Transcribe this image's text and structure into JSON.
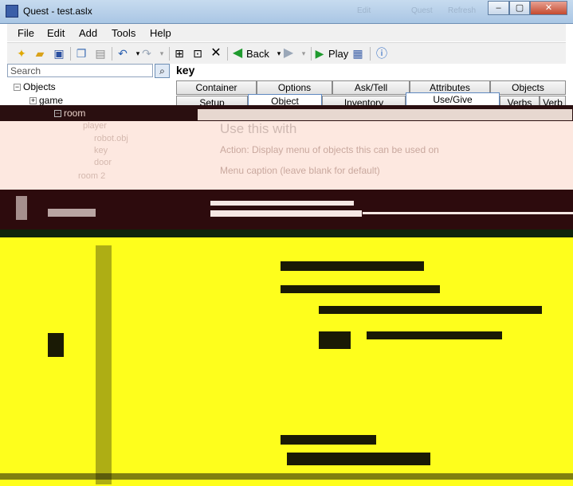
{
  "window": {
    "title": "Quest - test.aslx",
    "ghost_menu": [
      "Edit",
      "Quest",
      "Refresh"
    ],
    "controls": [
      "–",
      "▢",
      "✕"
    ]
  },
  "menu": [
    "File",
    "Edit",
    "Add",
    "Tools",
    "Help"
  ],
  "toolbar": {
    "back_label": "Back",
    "play_label": "Play",
    "icons": [
      "new-file-icon",
      "open-folder-icon",
      "save-icon",
      "copy-icon",
      "paste-icon",
      "undo-icon",
      "redo-icon",
      "add-object-icon",
      "add-room-icon",
      "delete-icon",
      "back-icon",
      "forward-icon",
      "play-icon",
      "log-icon",
      "help-icon"
    ]
  },
  "search": {
    "placeholder": "Search"
  },
  "selected_object": "key",
  "tree": {
    "root": "Objects",
    "game": "game",
    "room": "room",
    "ghost_children": [
      "player",
      "robot.obj",
      "key",
      "door",
      "room 2"
    ]
  },
  "tabs": {
    "row1": [
      "Container",
      "Options",
      "Ask/Tell",
      "Attributes",
      "Objects"
    ],
    "row2": [
      "Setup",
      "Object",
      "Inventory",
      "Use/Give",
      "Verbs",
      "Verb"
    ]
  },
  "panel": {
    "heading": "Use this with",
    "action_line": "Action:    Display menu of objects this can be used on",
    "menu_caption": "Menu caption (leave blank for default)"
  },
  "colors": {
    "titlebar": "#b7cfe8",
    "chrome": "#f0f0f0",
    "accent": "#5e88c0",
    "corrupt_dark": "#2a0f10",
    "corrupt_yellow": "#fefe1c"
  }
}
